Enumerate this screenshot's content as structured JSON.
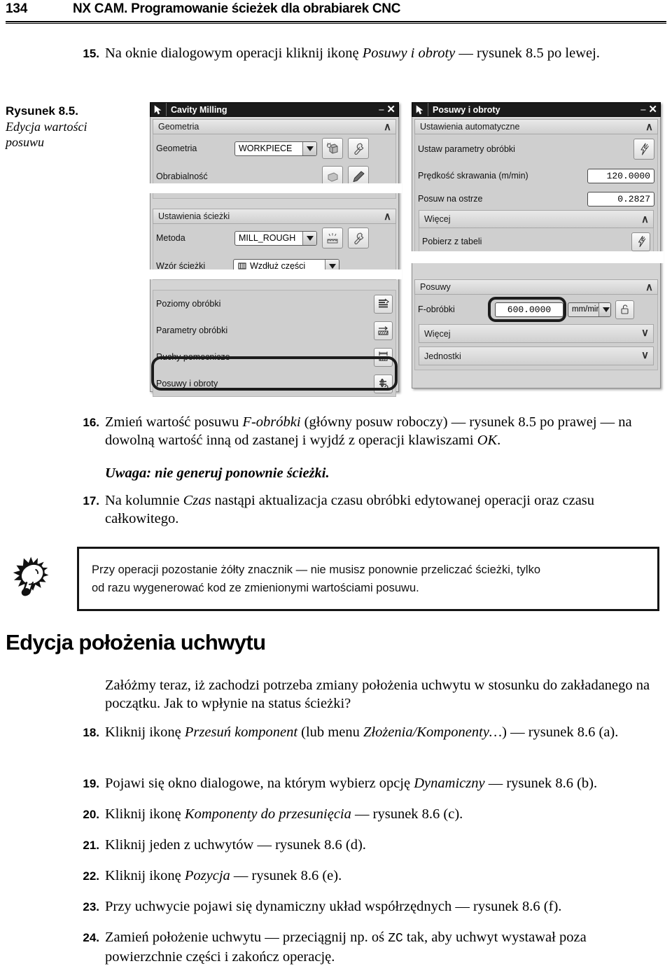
{
  "header": {
    "page_number": "134",
    "title": "NX CAM. Programowanie ścieżek dla obrabiarek CNC"
  },
  "figure_caption": {
    "label": "Rysunek 8.5.",
    "line1": "Edycja wartości",
    "line2": "posuwu"
  },
  "steps": {
    "s15": {
      "num": "15.",
      "t1": "Na oknie dialogowym operacji kliknij ikonę ",
      "i1": "Posuwy i obroty",
      "t2": " — rysunek 8.5 po lewej."
    },
    "s16": {
      "num": "16.",
      "t1": "Zmień wartość posuwu ",
      "i1": "F-obróbki",
      "t2": " (główny posuw roboczy) — rysunek 8.5 po prawej — na dowolną wartość inną od zastanej i wyjdź z operacji klawiszami ",
      "i2": "OK",
      "t3": "."
    },
    "note16": "Uwaga: nie generuj ponownie ścieżki.",
    "s17": {
      "num": "17.",
      "t1": "Na kolumnie ",
      "i1": "Czas",
      "t2": " nastąpi aktualizacja czasu obróbki edytowanej operacji oraz czasu całkowitego."
    },
    "s18": {
      "num": "18.",
      "t1": "Kliknij ikonę ",
      "i1": "Przesuń komponent",
      "t2": " (lub menu ",
      "i2": "Złożenia/Komponenty…",
      "t3": ") — rysunek 8.6 (a)."
    },
    "s19": {
      "num": "19.",
      "t1": "Pojawi się okno dialogowe, na którym wybierz opcję ",
      "i1": "Dynamiczny",
      "t2": " — rysunek 8.6 (b)."
    },
    "s20": {
      "num": "20.",
      "t1": "Kliknij ikonę ",
      "i1": "Komponenty do przesunięcia",
      "t2": " — rysunek 8.6 (c)."
    },
    "s21": {
      "num": "21.",
      "t1": "Kliknij jeden z uchwytów — rysunek 8.6 (d)."
    },
    "s22": {
      "num": "22.",
      "t1": "Kliknij ikonę ",
      "i1": "Pozycja",
      "t2": " — rysunek 8.6 (e)."
    },
    "s23": {
      "num": "23.",
      "t1": "Przy uchwycie pojawi się dynamiczny układ współrzędnych — rysunek 8.6 (f)."
    },
    "s24": {
      "num": "24.",
      "t1": "Zamień położenie uchwytu — przeciągnij np. oś ",
      "m1": "ZC",
      "t2": " tak, aby uchwyt wystawał poza powierzchnie części i zakończ operację."
    }
  },
  "tip": {
    "line1": "Przy operacji pozostanie żółty znacznik — nie musisz ponownie przeliczać ścieżki, tylko",
    "line2": "od razu wygenerować kod ze zmienionymi wartościami posuwu."
  },
  "section": {
    "heading": "Edycja położenia uchwytu",
    "paragraph": "Załóżmy teraz, iż zachodzi potrzeba zmiany położenia uchwytu w stosunku do zakładanego na początku. Jak to wpłynie na status ścieżki?"
  },
  "dialog_left": {
    "title": "Cavity Milling",
    "minimize": "–",
    "close": "✕",
    "group_geometry": "Geometria",
    "row_geometry_label": "Geometria",
    "row_geometry_value": "WORKPIECE",
    "row_partial_label": "Obrabialność",
    "group_path_settings": "Ustawienia ścieżki",
    "row_method_label": "Metoda",
    "row_method_value": "MILL_ROUGH",
    "row_pattern_label": "Wzór ścieżki",
    "row_pattern_value": "Wzdłuż części",
    "row_levels_label": "Poziomy obróbki",
    "row_params_label": "Parametry obróbki",
    "row_nonCutting_label": "Ruchy pomocnicze",
    "row_feeds_label": "Posuwy i obroty"
  },
  "dialog_right": {
    "title": "Posuwy i obroty",
    "minimize": "–",
    "close": "✕",
    "group_auto": "Ustawienia automatyczne",
    "row_setparams_label": "Ustaw parametry obróbki",
    "row_cutspeed_label": "Prędkość skrawania (m/min)",
    "row_cutspeed_value": "120.0000",
    "row_feedtooth_label": "Posuw na ostrze",
    "row_feedtooth_value": "0.2827",
    "group_more_1": "Więcej",
    "row_fromtable_label": "Pobierz z tabeli",
    "group_feeds": "Posuwy",
    "row_fcut_label": "F-obróbki",
    "row_fcut_value": "600.0000",
    "row_fcut_units": "mm/mir",
    "group_more_2": "Więcej",
    "group_units": "Jednostki"
  }
}
